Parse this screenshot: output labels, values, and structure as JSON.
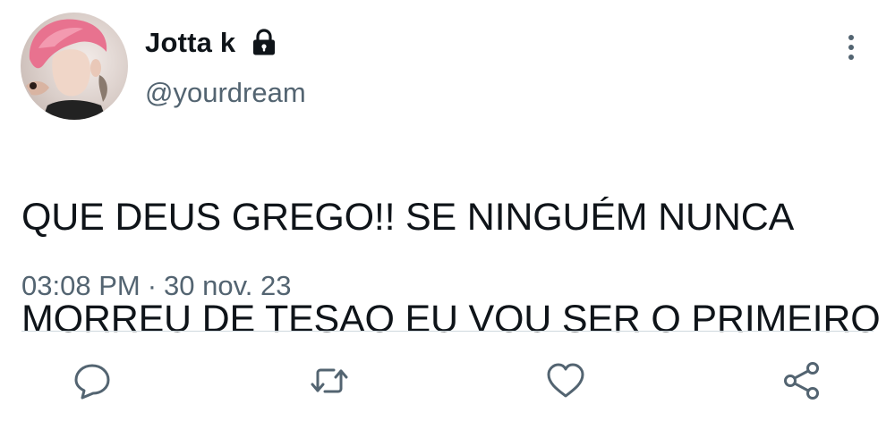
{
  "author": {
    "display_name": "Jotta k",
    "handle": "@yourdream",
    "protected": true,
    "avatar_icon": "profile-photo"
  },
  "tweet": {
    "text_line_1": "QUE DEUS GREGO!! SE NINGUÉM NUNCA",
    "text_line_2": "MORREU DE TESAO EU VOU SER O PRIMEIRO",
    "time": "03:08 PM",
    "separator": "·",
    "date": "30 nov. 23"
  },
  "actions": [
    {
      "icon": "reply-icon"
    },
    {
      "icon": "retweet-icon"
    },
    {
      "icon": "like-icon"
    },
    {
      "icon": "share-icon"
    }
  ],
  "colors": {
    "text": "#0f1419",
    "secondary_text": "#536471",
    "icon": "#536471",
    "divider": "#cfd9de",
    "background": "#ffffff"
  }
}
